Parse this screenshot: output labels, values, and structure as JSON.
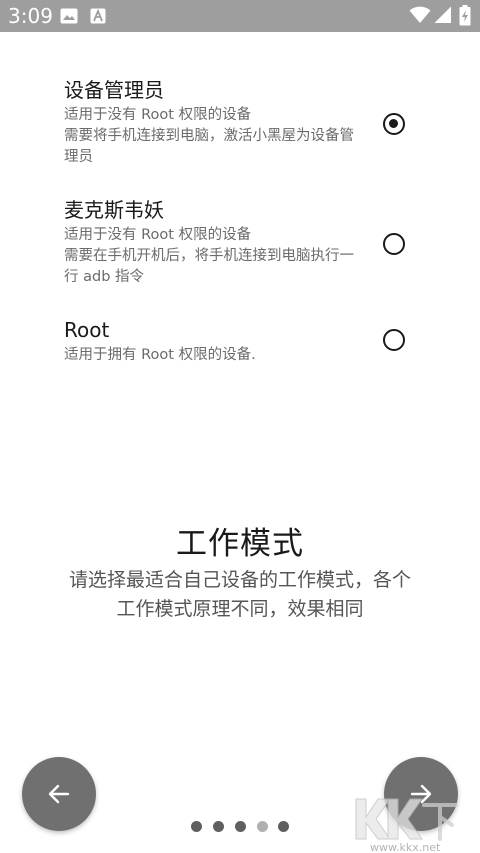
{
  "status_bar": {
    "time": "3:09",
    "icons_left": [
      "image-icon",
      "a-letter-icon"
    ],
    "icons_right": [
      "wifi-icon",
      "signal-icon",
      "battery-charging-icon"
    ],
    "background": "#9e9e9e"
  },
  "options": [
    {
      "title": "设备管理员",
      "desc_line1": "适用于没有 Root 权限的设备",
      "desc_line2": "需要将手机连接到电脑，激活小黑屋为设备管理员",
      "selected": true
    },
    {
      "title": "麦克斯韦妖",
      "desc_line1": "适用于没有 Root 权限的设备",
      "desc_line2": "需要在手机开机后，将手机连接到电脑执行一行 adb 指令",
      "selected": false
    },
    {
      "title": "Root",
      "desc_line1": "适用于拥有 Root 权限的设备.",
      "selected": false
    }
  ],
  "intro": {
    "title": "工作模式",
    "subtitle": "请选择最适合自己设备的工作模式，各个工作模式原理不同，效果相同"
  },
  "navigation": {
    "back_icon": "arrow-left-icon",
    "next_icon": "arrow-right-icon",
    "page_count": 5,
    "current_page": 4
  },
  "watermark": {
    "logo_text": "KK下载",
    "url": "www.kkx.net"
  },
  "colors": {
    "status_bar": "#9e9e9e",
    "nav_button": "#707070",
    "dot": "#5f5f5f",
    "dot_active": "#b0b0b0"
  }
}
